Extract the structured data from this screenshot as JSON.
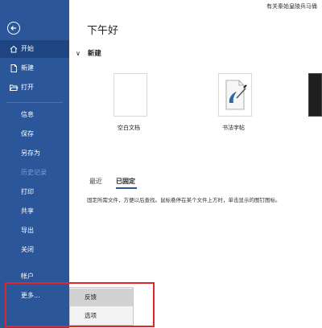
{
  "window": {
    "top_text": "有关秦始皇陵兵马俑"
  },
  "sidebar": {
    "items": [
      {
        "id": "home",
        "label": "开始",
        "icon": "home-icon",
        "active": true
      },
      {
        "id": "new",
        "label": "新建",
        "icon": "new-document-icon"
      },
      {
        "id": "open",
        "label": "打开",
        "icon": "folder-open-icon"
      },
      {
        "id": "info",
        "label": "信息"
      },
      {
        "id": "save",
        "label": "保存"
      },
      {
        "id": "saveas",
        "label": "另存为"
      },
      {
        "id": "history",
        "label": "历史记录",
        "disabled": true
      },
      {
        "id": "print",
        "label": "打印"
      },
      {
        "id": "share",
        "label": "共享"
      },
      {
        "id": "export",
        "label": "导出"
      },
      {
        "id": "close",
        "label": "关闭"
      },
      {
        "id": "account",
        "label": "帐户"
      },
      {
        "id": "more",
        "label": "更多..."
      }
    ]
  },
  "main": {
    "greeting": "下午好",
    "new_section": {
      "title": "新建",
      "templates": [
        {
          "label": "空白文档"
        },
        {
          "label": "书法字帖"
        }
      ]
    },
    "tabs": [
      {
        "label": "最近"
      },
      {
        "label": "已固定",
        "active": true
      }
    ],
    "pinned_hint": "固定所需文件，方便以后查找。鼠标悬停在某个文件上方时，单击显示的图钉图标。"
  },
  "more_menu": {
    "items": [
      {
        "label": "反馈",
        "hover": true
      },
      {
        "label": "选项"
      }
    ]
  },
  "colors": {
    "sidebar_bg": "#2b579a",
    "highlight_border": "#e0262a"
  }
}
